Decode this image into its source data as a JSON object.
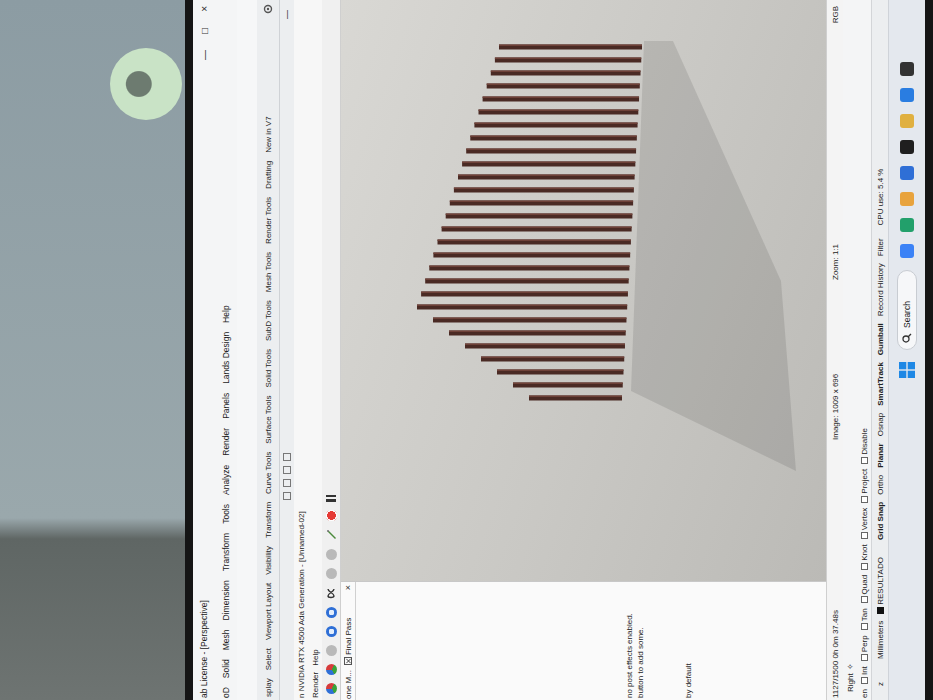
{
  "window": {
    "title": "ab License - [Perspective]",
    "controls": [
      "—",
      "□",
      "×"
    ]
  },
  "menu": [
    "oD",
    "Solid",
    "Mesh",
    "Dimension",
    "Transform",
    "Tools",
    "Analyze",
    "Render",
    "Panels",
    "Lands Design",
    "Help"
  ],
  "toolbar_tabs": [
    {
      "label": "splay",
      "selected": false
    },
    {
      "label": "Select",
      "selected": false
    },
    {
      "label": "Viewport Layout",
      "selected": false
    },
    {
      "label": "Visibility",
      "selected": false
    },
    {
      "label": "Transform",
      "selected": false
    },
    {
      "label": "Curve Tools",
      "selected": false
    },
    {
      "label": "Surface Tools",
      "selected": false
    },
    {
      "label": "Solid Tools",
      "selected": false
    },
    {
      "label": "SubD Tools",
      "selected": false
    },
    {
      "label": "Mesh Tools",
      "selected": false
    },
    {
      "label": "Render Tools",
      "selected": false
    },
    {
      "label": "Drafting",
      "selected": false
    },
    {
      "label": "New in V7",
      "selected": false
    }
  ],
  "panel_minimize": "—",
  "render_window": {
    "title": "n NVIDIA RTX 4500 Ada Generation - [Unnamed-02]",
    "menu": [
      "Render",
      "Help"
    ]
  },
  "post_effects_panel": {
    "tabs": [
      {
        "label": "one M...",
        "selected": false,
        "checked": false
      },
      {
        "label": "Final Pass",
        "selected": true,
        "checked": true
      }
    ],
    "close": "×",
    "messages": [
      "no post effects enabled.",
      "button to add some."
    ],
    "note": "by default"
  },
  "render_status": {
    "progress": "1127/1500 0h 0m 37.48s",
    "image": "Image: 1009 x 696",
    "zoom": "Zoom: 1:1",
    "channel": "RGB"
  },
  "viewport_tab": {
    "label": "Right",
    "icon": "✧"
  },
  "osnap": {
    "prefix": "en",
    "items": [
      {
        "label": "Int",
        "checked": false
      },
      {
        "label": "Perp",
        "checked": false
      },
      {
        "label": "Tan",
        "checked": false
      },
      {
        "label": "Quad",
        "checked": false
      },
      {
        "label": "Knot",
        "checked": false
      },
      {
        "label": "Vertex",
        "checked": false
      },
      {
        "label": "Project",
        "checked": false
      },
      {
        "label": "Disable",
        "checked": false
      }
    ]
  },
  "status_bar": {
    "coordinate": "z",
    "units": "Millimeters",
    "layer": {
      "name": "RESULTADO",
      "color": "#111111"
    },
    "toggles": [
      {
        "label": "Grid Snap",
        "on": true
      },
      {
        "label": "Ortho",
        "on": false
      },
      {
        "label": "Planar",
        "on": true
      },
      {
        "label": "Osnap",
        "on": false
      },
      {
        "label": "SmartTrack",
        "on": true
      },
      {
        "label": "Gumball",
        "on": true
      },
      {
        "label": "Record History",
        "on": false
      },
      {
        "label": "Filter",
        "on": false
      }
    ],
    "cpu": "CPU use: 5.4 %"
  },
  "taskbar": {
    "search": "Search"
  }
}
